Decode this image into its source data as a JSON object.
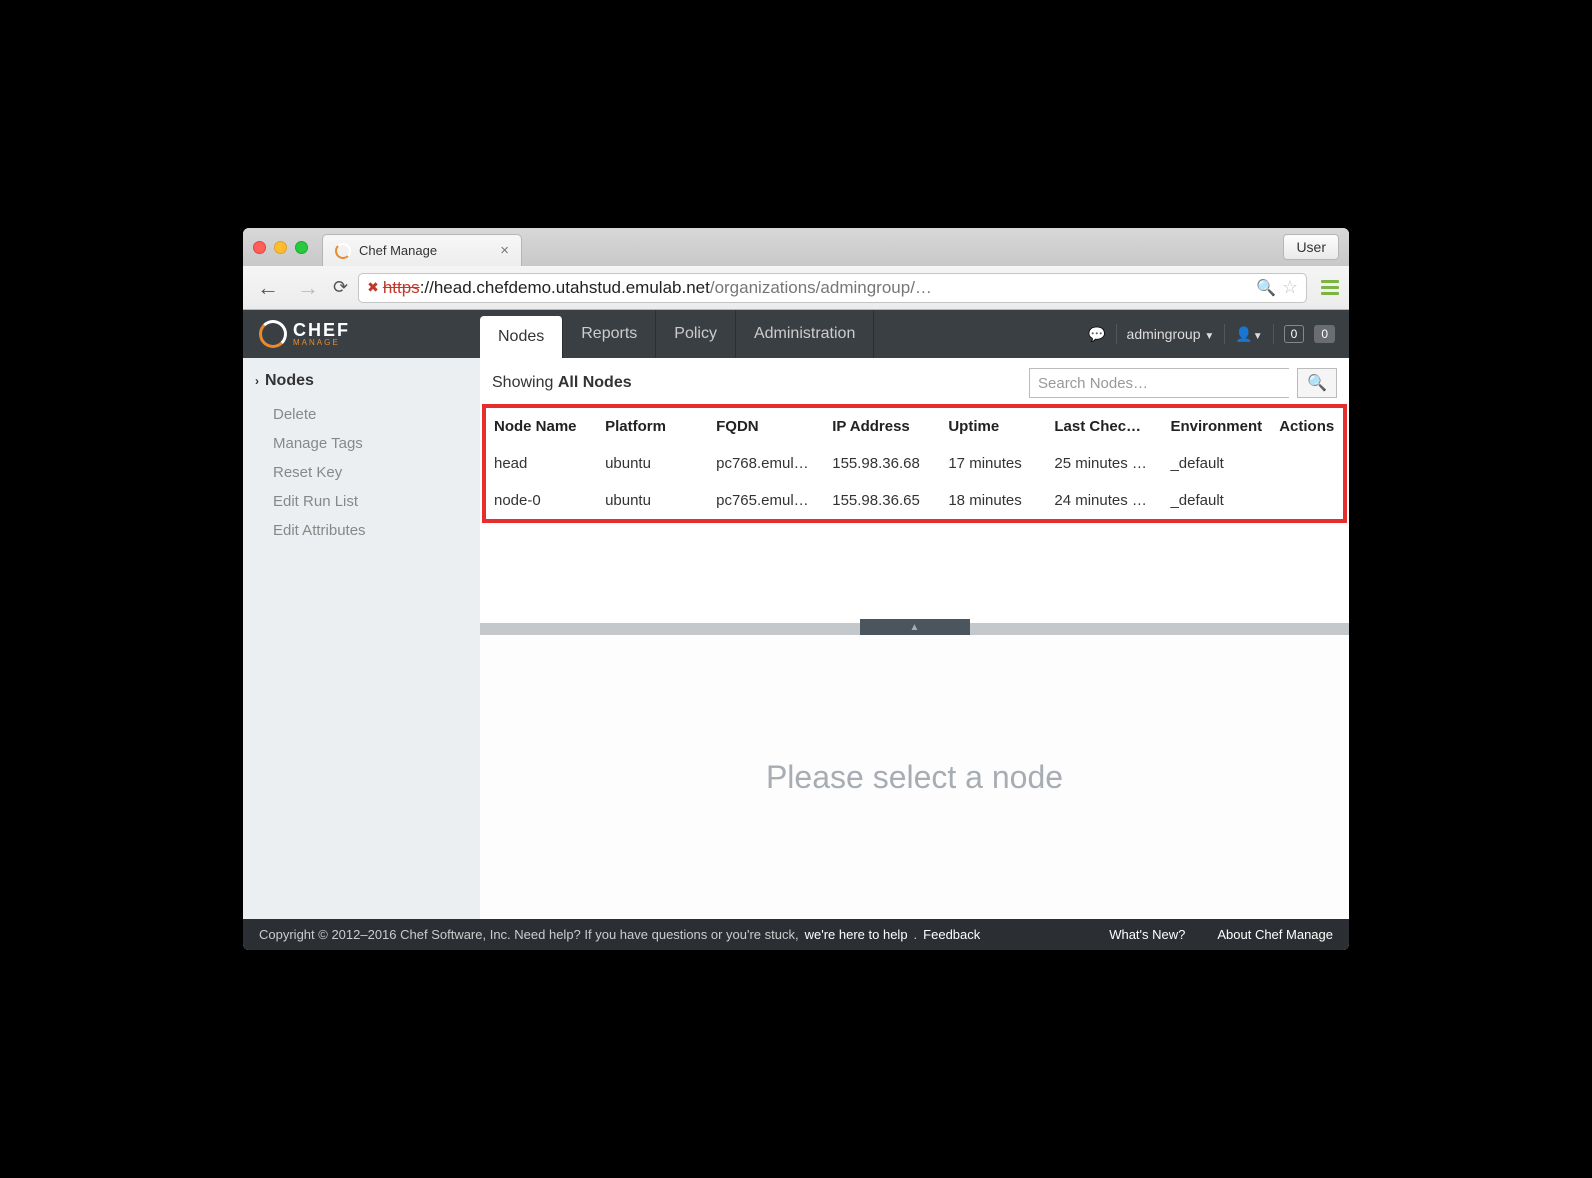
{
  "browser": {
    "tab_title": "Chef Manage",
    "user_button": "User",
    "url_https": "https",
    "url_host": "://head.chefdemo.utahstud.emulab.net",
    "url_path": "/organizations/admingroup/…"
  },
  "header": {
    "logo_main": "CHEF",
    "logo_sub": "MANAGE",
    "tabs": [
      {
        "label": "Nodes",
        "active": true
      },
      {
        "label": "Reports",
        "active": false
      },
      {
        "label": "Policy",
        "active": false
      },
      {
        "label": "Administration",
        "active": false
      }
    ],
    "org_name": "admingroup",
    "badge1": "0",
    "badge2": "0"
  },
  "sidebar": {
    "section": "Nodes",
    "items": [
      "Delete",
      "Manage Tags",
      "Reset Key",
      "Edit Run List",
      "Edit Attributes"
    ]
  },
  "filter": {
    "showing_prefix": "Showing ",
    "showing_bold": "All Nodes",
    "search_placeholder": "Search Nodes…"
  },
  "table": {
    "columns": [
      "Node Name",
      "Platform",
      "FQDN",
      "IP Address",
      "Uptime",
      "Last Chec…",
      "Environment",
      "Actions"
    ],
    "rows": [
      {
        "node_name": "head",
        "platform": "ubuntu",
        "fqdn": "pc768.emul…",
        "ip": "155.98.36.68",
        "uptime": "17 minutes",
        "last_check": "25 minutes …",
        "environment": "_default",
        "actions": ""
      },
      {
        "node_name": "node-0",
        "platform": "ubuntu",
        "fqdn": "pc765.emul…",
        "ip": "155.98.36.65",
        "uptime": "18 minutes",
        "last_check": "24 minutes …",
        "environment": "_default",
        "actions": ""
      }
    ]
  },
  "detail_prompt": "Please select a node",
  "footer": {
    "copyright": "Copyright © 2012–2016 Chef Software, Inc. Need help? If you have questions or you're stuck, ",
    "help_link": "we're here to help",
    "feedback": "Feedback",
    "whatsnew": "What's New?",
    "about": "About Chef Manage"
  }
}
